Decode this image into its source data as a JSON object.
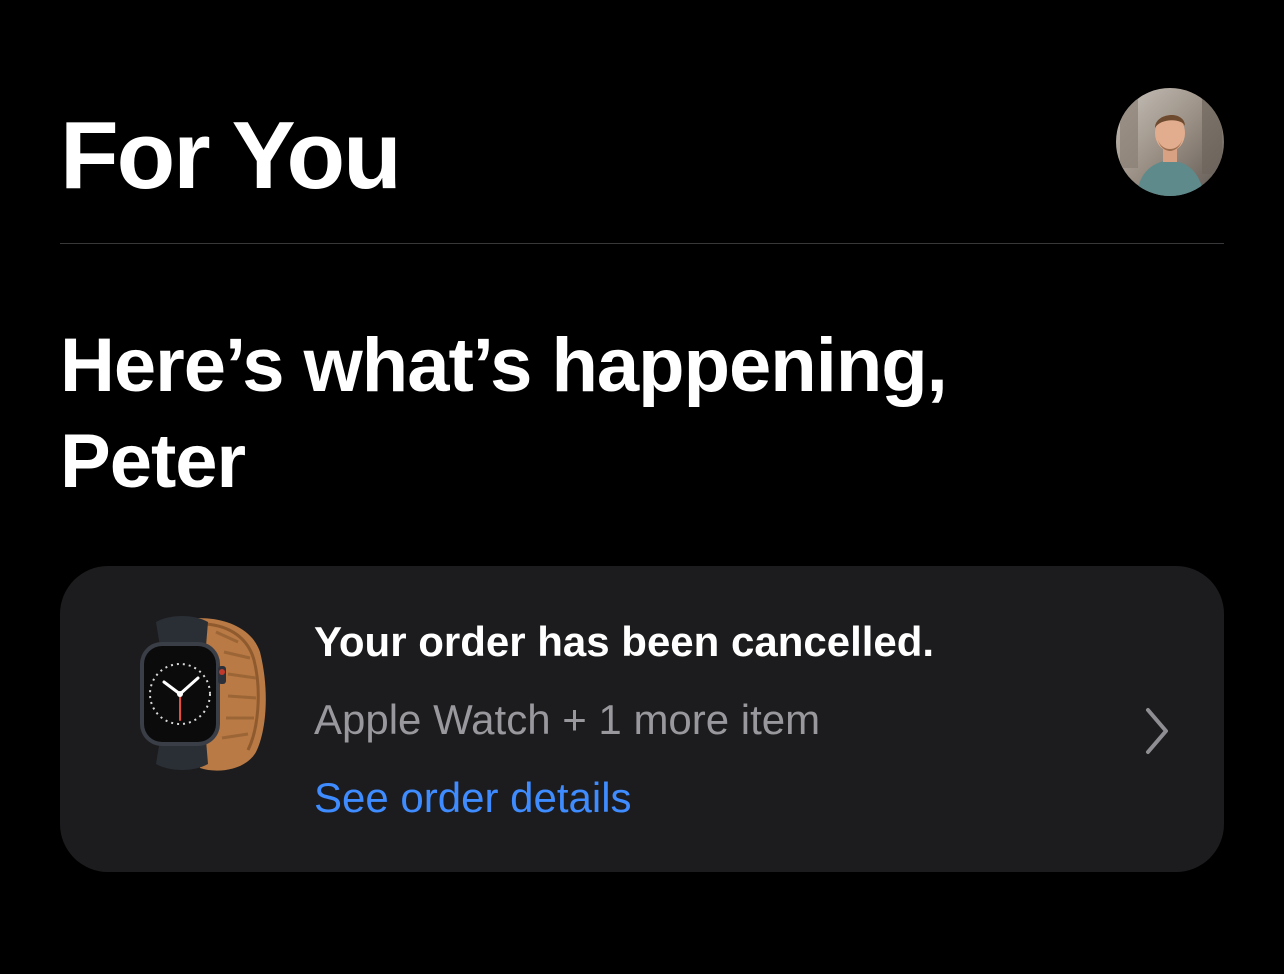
{
  "header": {
    "title": "For You",
    "avatar_icon": "user-avatar-icon"
  },
  "greeting": {
    "text": "Here’s what’s happening, Peter"
  },
  "order_card": {
    "status": "Your order has been cancelled.",
    "items": "Apple Watch + 1 more item",
    "link": "See order details",
    "thumbnail_icon": "apple-watch-icon",
    "chevron_icon": "chevron-right-icon"
  },
  "colors": {
    "background": "#000000",
    "card": "#1c1c1e",
    "link": "#3e8cff",
    "secondary_text": "#98989d"
  }
}
